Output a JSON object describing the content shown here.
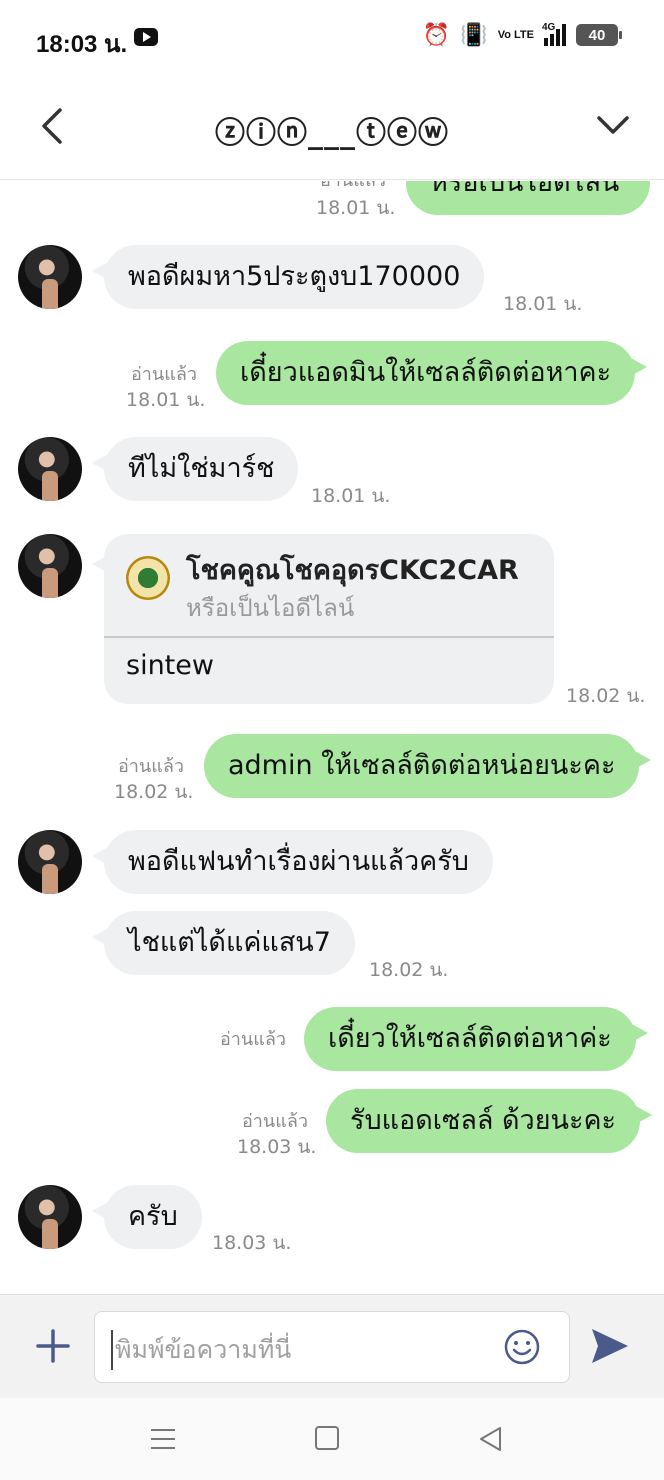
{
  "status_bar": {
    "time": "18:03 น.",
    "network": "4G",
    "volte": "Vo LTE",
    "battery": "40"
  },
  "header": {
    "title": "ⓩⓘⓝ___ⓣⓔⓦ"
  },
  "messages": {
    "m0": {
      "text": "หรือเป็นไอดีไลน์",
      "time": "18.01 น.",
      "read": "อ่านแล้ว"
    },
    "m1": {
      "text": "พอดีผมหา5ประตูงบ170000",
      "time": "18.01 น."
    },
    "m2": {
      "text": "เดี๋ยวแอดมินให้เซลล์ติดต่อหาคะ",
      "read": "อ่านแล้ว",
      "time": "18.01 น."
    },
    "m3": {
      "text": "ทีไม่ใช่มาร์ช",
      "time": "18.01 น."
    },
    "m4": {
      "card_title": "โชคคูณโชคอุดรCKC2CAR",
      "card_subtitle": "หรือเป็นไอดีไลน์",
      "text": "sintew",
      "time": "18.02 น."
    },
    "m5": {
      "text": "admin ให้เซลล์ติดต่อหน่อยนะคะ",
      "read": "อ่านแล้ว",
      "time": "18.02 น."
    },
    "m6": {
      "text": "พอดีแฟนทำเรื่องผ่านแล้วครับ"
    },
    "m7": {
      "text": "ไชแต่ได้แค่แสน7",
      "time": "18.02 น."
    },
    "m8": {
      "text": "เดี๋ยวให้เซลล์ติดต่อหาค่ะ",
      "read": "อ่านแล้ว"
    },
    "m9": {
      "text": "รับแอดเซลล์ ด้วยนะคะ",
      "read": "อ่านแล้ว",
      "time": "18.03 น."
    },
    "m10": {
      "text": "ครับ",
      "time": "18.03 น."
    }
  },
  "input": {
    "placeholder": "พิมพ์ข้อความที่นี่"
  },
  "icons": [
    "back-icon",
    "chevron-down-icon",
    "plus-icon",
    "emoji-icon",
    "send-icon",
    "menu-icon",
    "home-icon",
    "nav-back-icon"
  ],
  "colors": {
    "outgoing_bubble": "#a9e6a0",
    "incoming_bubble": "#eef0f2",
    "send": "#4a5a8a"
  }
}
